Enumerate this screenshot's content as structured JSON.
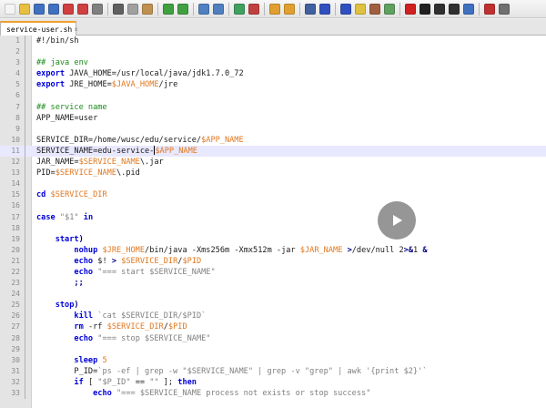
{
  "toolbar": {
    "buttons": [
      {
        "icon": "new-file-icon",
        "color": "#f4f4f4"
      },
      {
        "icon": "open-folder-icon",
        "color": "#e8c040"
      },
      {
        "icon": "save-icon",
        "color": "#4070c0"
      },
      {
        "icon": "save-all-icon",
        "color": "#4070c0"
      },
      {
        "icon": "close-icon",
        "color": "#d04040"
      },
      {
        "icon": "close-all-icon",
        "color": "#d04040"
      },
      {
        "icon": "print-icon",
        "color": "#808080"
      },
      {
        "sep": true
      },
      {
        "icon": "cut-icon",
        "color": "#606060"
      },
      {
        "icon": "copy-icon",
        "color": "#a0a0a0"
      },
      {
        "icon": "paste-icon",
        "color": "#c09050"
      },
      {
        "sep": true
      },
      {
        "icon": "undo-icon",
        "color": "#40a040"
      },
      {
        "icon": "redo-icon",
        "color": "#40a040"
      },
      {
        "sep": true
      },
      {
        "icon": "find-icon",
        "color": "#5080c0"
      },
      {
        "icon": "replace-icon",
        "color": "#5080c0"
      },
      {
        "sep": true
      },
      {
        "icon": "zoom-in-icon",
        "color": "#40a060"
      },
      {
        "icon": "zoom-out-icon",
        "color": "#c04040"
      },
      {
        "sep": true
      },
      {
        "icon": "sync-vertical-icon",
        "color": "#e0a030"
      },
      {
        "icon": "sync-horizontal-icon",
        "color": "#e0a030"
      },
      {
        "sep": true
      },
      {
        "icon": "word-wrap-icon",
        "color": "#4060a0"
      },
      {
        "icon": "show-all-chars-icon",
        "color": "#3050c0"
      },
      {
        "sep": true
      },
      {
        "icon": "indent-guide-icon",
        "color": "#3050c0"
      },
      {
        "icon": "lang-define-icon",
        "color": "#e0c040"
      },
      {
        "icon": "document-map-icon",
        "color": "#a06040"
      },
      {
        "icon": "function-list-icon",
        "color": "#60a060"
      },
      {
        "sep": true
      },
      {
        "icon": "record-macro-icon",
        "color": "#d02020"
      },
      {
        "icon": "stop-macro-icon",
        "color": "#202020"
      },
      {
        "icon": "play-macro-icon",
        "color": "#303030"
      },
      {
        "icon": "run-macro-icon",
        "color": "#303030"
      },
      {
        "icon": "save-macro-icon",
        "color": "#4070c0"
      },
      {
        "sep": true
      },
      {
        "icon": "spellcheck-icon",
        "color": "#c03030"
      },
      {
        "icon": "settings-icon",
        "color": "#707070"
      }
    ]
  },
  "tab": {
    "label": "service-user.sh",
    "close": "×"
  },
  "editor": {
    "current_line": 11,
    "lines": [
      {
        "n": "1",
        "t": [
          [
            "",
            "#!/bin/"
          ],
          [
            "",
            "sh"
          ]
        ]
      },
      {
        "n": "2",
        "t": []
      },
      {
        "n": "3",
        "t": [
          [
            "cm",
            "## java env"
          ]
        ]
      },
      {
        "n": "4",
        "t": [
          [
            "kw",
            "export"
          ],
          [
            "",
            " JAVA_HOME=/usr/local/java/jdk1.7.0_72"
          ]
        ]
      },
      {
        "n": "5",
        "t": [
          [
            "kw",
            "export"
          ],
          [
            "",
            " JRE_HOME="
          ],
          [
            "vr",
            "$JAVA_HOME"
          ],
          [
            "",
            "/jre"
          ]
        ]
      },
      {
        "n": "6",
        "t": []
      },
      {
        "n": "7",
        "t": [
          [
            "cm",
            "## service name"
          ]
        ]
      },
      {
        "n": "8",
        "t": [
          [
            "",
            "APP_NAME=user"
          ]
        ]
      },
      {
        "n": "9",
        "t": []
      },
      {
        "n": "10",
        "t": [
          [
            "",
            "SERVICE_DIR=/home/wusc/edu/service/"
          ],
          [
            "vr",
            "$APP_NAME"
          ]
        ]
      },
      {
        "n": "11",
        "t": [
          [
            "",
            "SERVICE_NAME=edu-service-"
          ],
          [
            "cur",
            ""
          ],
          [
            "vr",
            "$APP_NAME"
          ]
        ]
      },
      {
        "n": "12",
        "t": [
          [
            "",
            "JAR_NAME="
          ],
          [
            "vr",
            "$SERVICE_NAME"
          ],
          [
            "",
            "\\.jar"
          ]
        ]
      },
      {
        "n": "13",
        "t": [
          [
            "",
            "PID="
          ],
          [
            "vr",
            "$SERVICE_NAME"
          ],
          [
            "",
            "\\.pid"
          ]
        ]
      },
      {
        "n": "14",
        "t": []
      },
      {
        "n": "15",
        "t": [
          [
            "kw",
            "cd"
          ],
          [
            "",
            " "
          ],
          [
            "vr",
            "$SERVICE_DIR"
          ]
        ]
      },
      {
        "n": "16",
        "t": []
      },
      {
        "n": "17",
        "t": [
          [
            "kw",
            "case"
          ],
          [
            "",
            " "
          ],
          [
            "st",
            "\"$1\""
          ],
          [
            "",
            " "
          ],
          [
            "kw",
            "in"
          ]
        ]
      },
      {
        "n": "18",
        "t": []
      },
      {
        "n": "19",
        "t": [
          [
            "",
            "    "
          ],
          [
            "kw",
            "start"
          ],
          [
            "op",
            ")"
          ]
        ]
      },
      {
        "n": "20",
        "t": [
          [
            "",
            "        "
          ],
          [
            "kw",
            "nohup"
          ],
          [
            "",
            " "
          ],
          [
            "vr",
            "$JRE_HOME"
          ],
          [
            "",
            "/bin/java -Xms256m -Xmx512m -jar "
          ],
          [
            "vr",
            "$JAR_NAME"
          ],
          [
            "",
            " "
          ],
          [
            "op",
            ">"
          ],
          [
            "",
            "/dev/null 2"
          ],
          [
            "op",
            ">&"
          ],
          [
            "",
            "1 "
          ],
          [
            "op",
            "&"
          ]
        ]
      },
      {
        "n": "21",
        "t": [
          [
            "",
            "        "
          ],
          [
            "kw",
            "echo"
          ],
          [
            "",
            " $! "
          ],
          [
            "op",
            ">"
          ],
          [
            "",
            " "
          ],
          [
            "vr",
            "$SERVICE_DIR"
          ],
          [
            "",
            "/"
          ],
          [
            "vr",
            "$PID"
          ]
        ]
      },
      {
        "n": "22",
        "t": [
          [
            "",
            "        "
          ],
          [
            "kw",
            "echo"
          ],
          [
            "",
            " "
          ],
          [
            "st",
            "\"=== start $SERVICE_NAME\""
          ]
        ]
      },
      {
        "n": "23",
        "t": [
          [
            "",
            "        "
          ],
          [
            "op",
            ";;"
          ]
        ]
      },
      {
        "n": "24",
        "t": []
      },
      {
        "n": "25",
        "t": [
          [
            "",
            "    "
          ],
          [
            "kw",
            "stop"
          ],
          [
            "op",
            ")"
          ]
        ]
      },
      {
        "n": "26",
        "t": [
          [
            "",
            "        "
          ],
          [
            "kw",
            "kill"
          ],
          [
            "",
            " "
          ],
          [
            "st",
            "`cat $SERVICE_DIR/$PID`"
          ]
        ]
      },
      {
        "n": "27",
        "t": [
          [
            "",
            "        "
          ],
          [
            "kw",
            "rm"
          ],
          [
            "",
            " -rf "
          ],
          [
            "vr",
            "$SERVICE_DIR"
          ],
          [
            "",
            "/"
          ],
          [
            "vr",
            "$PID"
          ]
        ]
      },
      {
        "n": "28",
        "t": [
          [
            "",
            "        "
          ],
          [
            "kw",
            "echo"
          ],
          [
            "",
            " "
          ],
          [
            "st",
            "\"=== stop $SERVICE_NAME\""
          ]
        ]
      },
      {
        "n": "29",
        "t": []
      },
      {
        "n": "30",
        "t": [
          [
            "",
            "        "
          ],
          [
            "kw",
            "sleep"
          ],
          [
            "",
            " "
          ],
          [
            "vr",
            "5"
          ]
        ]
      },
      {
        "n": "31",
        "t": [
          [
            "",
            "        P_ID="
          ],
          [
            "st",
            "`ps -ef | grep -w \"$SERVICE_NAME\" | grep -v \"grep\" | awk '{print $2}'`"
          ]
        ]
      },
      {
        "n": "32",
        "t": [
          [
            "",
            "        "
          ],
          [
            "kw",
            "if"
          ],
          [
            "",
            " [ "
          ],
          [
            "st",
            "\"$P_ID\""
          ],
          [
            "",
            " == "
          ],
          [
            "st",
            "\"\""
          ],
          [
            "",
            " ]; "
          ],
          [
            "kw",
            "then"
          ]
        ]
      },
      {
        "n": "33",
        "t": [
          [
            "",
            "            "
          ],
          [
            "kw",
            "echo"
          ],
          [
            "",
            " "
          ],
          [
            "st",
            "\"=== $SERVICE_NAME process not exists or stop success\""
          ]
        ]
      }
    ]
  },
  "video_overlay": {
    "icon": "play-icon"
  }
}
